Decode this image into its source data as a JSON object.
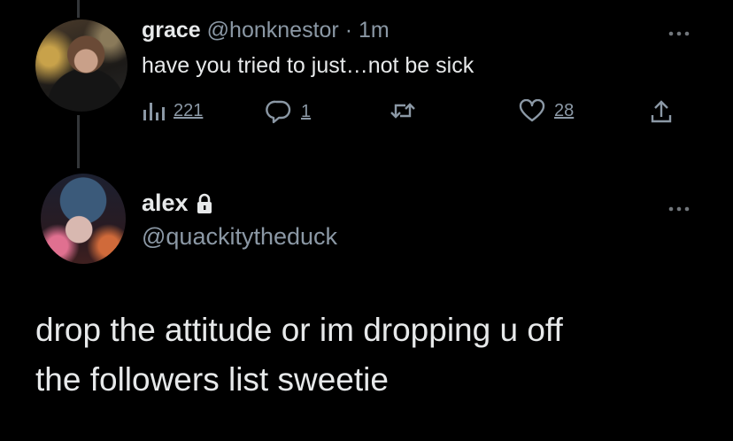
{
  "reply": {
    "name": "grace",
    "handle": "@honknestor",
    "separator": "·",
    "time": "1m",
    "text": "have you tried to just…not be sick",
    "actions": {
      "views": "221",
      "replies": "1",
      "likes": "28"
    }
  },
  "main": {
    "name": "alex",
    "protected_icon": "lock-icon",
    "handle": "@quackitytheduck",
    "text_line1": "drop the attitude or im dropping u off",
    "text_line2": "the followers list sweetie"
  },
  "icons": {
    "more": "more-icon",
    "views": "views-icon",
    "reply": "reply-icon",
    "retweet": "retweet-icon",
    "like": "like-icon",
    "share": "share-icon"
  },
  "colors": {
    "background": "#000000",
    "text": "#e7e9ea",
    "secondary": "#8b98a5"
  }
}
